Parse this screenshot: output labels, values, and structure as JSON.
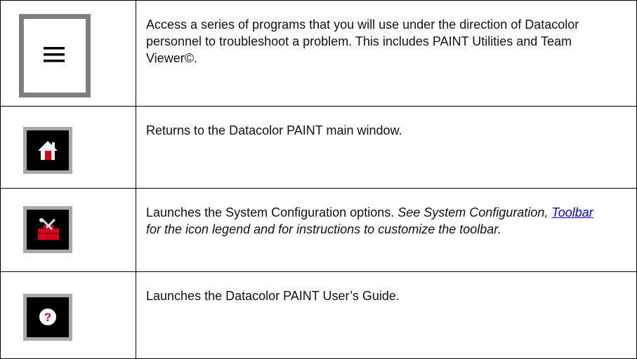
{
  "rows": [
    {
      "icon": "hamburger-menu-icon",
      "text": "Access a series of programs that you will use under the direction of Datacolor personnel to troubleshoot a problem. This includes PAINT Utilities and Team Viewer©."
    },
    {
      "icon": "home-icon",
      "text": "Returns to the Datacolor PAINT main window."
    },
    {
      "icon": "toolbox-icon",
      "text_plain": "Launches the System Configuration options.",
      "text_italic_1": "See System Configuration,",
      "link_label": "Toolbar",
      "text_italic_2": "for the icon legend and for instructions to customize the toolbar."
    },
    {
      "icon": "help-question-icon",
      "text": "Launches the Datacolor PAINT User’s Guide."
    }
  ],
  "colors": {
    "icon_red": "#d9001b",
    "icon_bg": "#000000",
    "icon_frame": "#a9a9a9",
    "link": "#0000ee"
  }
}
